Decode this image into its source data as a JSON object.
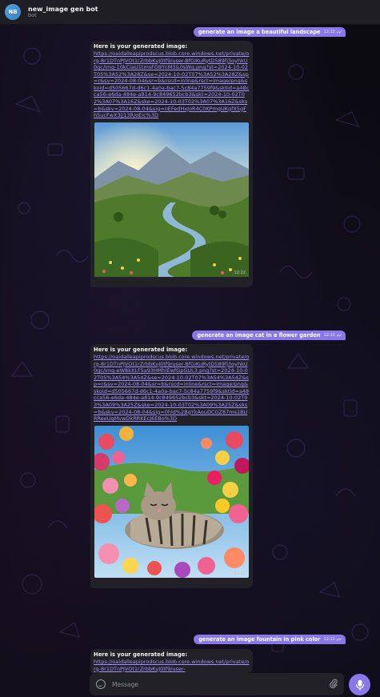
{
  "header": {
    "avatar_initials": "NB",
    "title": "new_image gen bot",
    "subtitle": "bot"
  },
  "messages": [
    {
      "type": "outgoing",
      "text": "generate an image a beautiful landscape",
      "time": "12:22"
    },
    {
      "type": "incoming",
      "title": "Here is your generated image:",
      "link": "https://oaidalleapiprodscus.blob.core.windows.net/private/org-8r1DTnPJVOt1rZrbbKvJ0tf9/user-BfGiKuRytD589fj3oyhkU0gc/img-10kCiaU1tmsFO9YcM3iL0sWq.png?st=2024-10-02T05%3A52%3A28Z&se=2024-10-02T07%3A52%3A28Z&sp=r&sv=2024-08-04&sr=b&rscd=inline&rsct=image/png&skoid=d505667d-d6c1-4a0a-bac7-5c84a7759f9&sktid=a48cca56-e6da-484e-a814-9c849652bcb3&skt=2024-10-02T02%3A07%3A16Z&ske=2024-10-03T02%3A07%3A16Z&sks=b&skv=2024-08-04&sig=nEFedHxJoR4C0KPmgUKgfX5gFh5ucFwX3jj13R/oEic%3D",
      "image_alt": "landscape",
      "time": "12:22"
    },
    {
      "type": "outgoing",
      "text": "generate an image cat in a flower garden",
      "time": "12:22"
    },
    {
      "type": "incoming",
      "title": "Here is your generated image:",
      "link": "https://oaidalleapiprodscus.blob.core.windows.net/private/org-8r1DTnPJVOt1rZrbbKvJ0tf9/user-BfGiKuRytD589fj3oyhkU0gc/img-eW8kXLFSa93HMhlEwfGpGUL3.png?st=2024-10-02T05%3A54%3A54Z&se=2024-10-02T07%3A54%3A54Z&sp=r&sv=2024-08-04&sr=b&rscd=inline&rsct=image/png&skoid=d505667d-d6c1-4a0a-bac7-5c84a7759f9&sktid=a48cca56-e6da-484e-a814-9c849652bcb3&skt=2024-10-02T03%3A09%3A25Z&ske=2024-10-03T02%3A09%3A25Z&sks=b&skv=2024-08-04&sig=0hld%2BgYkAouDCGZ87ms1BURReeUqMvwDkRRKEcJ6EBo%3D",
      "image_alt": "cat in flower garden",
      "time": "12:22"
    },
    {
      "type": "outgoing",
      "text": "generate an image fountain in pink  color",
      "time": "12:22"
    },
    {
      "type": "incoming",
      "title": "Here is your generated image:",
      "link": "https://oaidalleapiprodscus.blob.core.windows.net/private/org-8r1DTnPJVOt1rZrbbKvJ0tf9/user-"
    }
  ],
  "composer": {
    "placeholder": "Message",
    "emoji_icon": "smile-icon",
    "attach_icon": "paperclip-icon",
    "send_icon": "microphone-icon"
  },
  "colors": {
    "accent": "#8a78ea",
    "link": "#a493ff",
    "bubble_in": "#212127",
    "header": "#1e1e24"
  }
}
